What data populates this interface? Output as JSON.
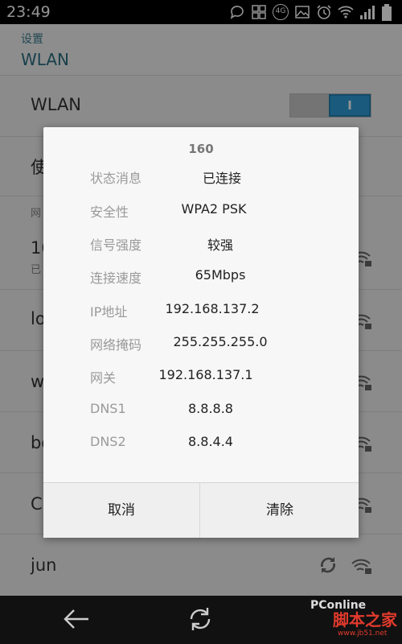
{
  "status_bar": {
    "time": "23:49",
    "network": "4G",
    "icons": [
      "chat-bubble-icon",
      "photo-icon",
      "network-4g-icon",
      "image-icon",
      "alarm-clock-icon",
      "wifi-icon",
      "signal-bars-icon",
      "battery-icon"
    ]
  },
  "header": {
    "parent_label": "设置",
    "title": "WLAN"
  },
  "wlan_row": {
    "label": "WLAN",
    "toggle_text": "I",
    "toggle_on": true
  },
  "list_rows": [
    {
      "title": "使",
      "subtitle": ""
    },
    {
      "title": "网",
      "subtitle": ""
    },
    {
      "title": "16",
      "subtitle": "已"
    },
    {
      "title": "lo",
      "subtitle": ""
    },
    {
      "title": "w",
      "subtitle": ""
    },
    {
      "title": "bo",
      "subtitle": ""
    },
    {
      "title": "Cl",
      "subtitle": ""
    },
    {
      "title": "jun",
      "subtitle": ""
    }
  ],
  "dialog": {
    "title": "160",
    "fields": [
      {
        "label": "状态消息",
        "value": "已连接"
      },
      {
        "label": "安全性",
        "value": "WPA2 PSK"
      },
      {
        "label": "信号强度",
        "value": "较强"
      },
      {
        "label": "连接速度",
        "value": "65Mbps"
      },
      {
        "label": "IP地址",
        "value": "192.168.137.2"
      },
      {
        "label": "网络掩码",
        "value": "255.255.255.0"
      },
      {
        "label": "网关",
        "value": "192.168.137.1"
      },
      {
        "label": "DNS1",
        "value": "8.8.8.8"
      },
      {
        "label": "DNS2",
        "value": "8.8.4.4"
      }
    ],
    "cancel_label": "取消",
    "clear_label": "清除"
  },
  "watermark": {
    "left": "PConline",
    "brand": "脚本之家",
    "url": "www.jb51.net"
  },
  "colors": {
    "accent": "#2e9ed8",
    "header_title": "#2a6f82"
  }
}
